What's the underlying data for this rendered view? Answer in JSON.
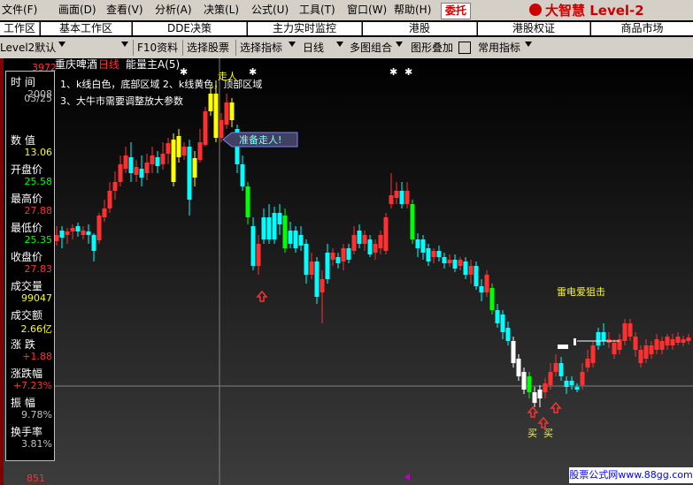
{
  "menu": [
    "文件(F)",
    "画面(D)",
    "查看(V)",
    "分析(A)",
    "决策(L)",
    "公式(U)",
    "工具(T)",
    "窗口(W)",
    "帮助(H)"
  ],
  "entrust_label": "委托",
  "brand": "大智慧 Level-2",
  "tabs": [
    "工作区",
    "基本工作区",
    "DDE决策",
    "主力实时监控",
    "港股",
    "港股权证",
    "商品市场"
  ],
  "toolbar": {
    "mode": "Level2默认",
    "f10": "F10资料",
    "select_stock": "选择股票",
    "select_indicator": "选择指标",
    "period": "日线",
    "multi_combo": "多图组合",
    "overlay": "图形叠加",
    "common_indicator": "常用指标"
  },
  "chart_header": {
    "stock": "重庆啤酒",
    "period": "日线",
    "indicator": "能量主A(5)"
  },
  "notes": [
    "1、k线白色，底部区域 2、k线黄色，顶部区域",
    "3、大牛市需要调整放大参数"
  ],
  "annotations": {
    "top": "走人",
    "ready": "准备走人!",
    "thunder": "雷电爱狙击",
    "buy1": "买",
    "buy2": "买"
  },
  "axis": {
    "top_price": "3972",
    "bottom_price": "851"
  },
  "info_panel": [
    {
      "label": "时  间",
      "value": "2008",
      "color": "#c0c0c0"
    },
    {
      "label": "",
      "value": "03/25",
      "color": "#c0c0c0"
    },
    {
      "label": "数  值",
      "value": "13.06",
      "color": "#ffff00"
    },
    {
      "label": "开盘价",
      "value": "25.58",
      "color": "#00ff00"
    },
    {
      "label": "最高价",
      "value": "27.88",
      "color": "#ff3030"
    },
    {
      "label": "最低价",
      "value": "25.35",
      "color": "#00ff00"
    },
    {
      "label": "收盘价",
      "value": "27.83",
      "color": "#ff3030"
    },
    {
      "label": "成交量",
      "value": "99047",
      "color": "#ffff00"
    },
    {
      "label": "成交额",
      "value": "2.66亿",
      "color": "#ffff00"
    },
    {
      "label": "涨  跌",
      "value": "+1.88",
      "color": "#ff3030"
    },
    {
      "label": "涨跌幅",
      "value": "+7.23%",
      "color": "#ff3030"
    },
    {
      "label": "振  幅",
      "value": "9.78%",
      "color": "#c0c0c0"
    },
    {
      "label": "换手率",
      "value": "3.81%",
      "color": "#c0c0c0"
    }
  ],
  "footer": "股票公式网www.88gg.com",
  "colors": {
    "up": "#ff3030",
    "down": "#00ffff",
    "top_zone": "#ffff00",
    "bottom_zone": "#ffffff",
    "signal": "#00ff00"
  }
}
